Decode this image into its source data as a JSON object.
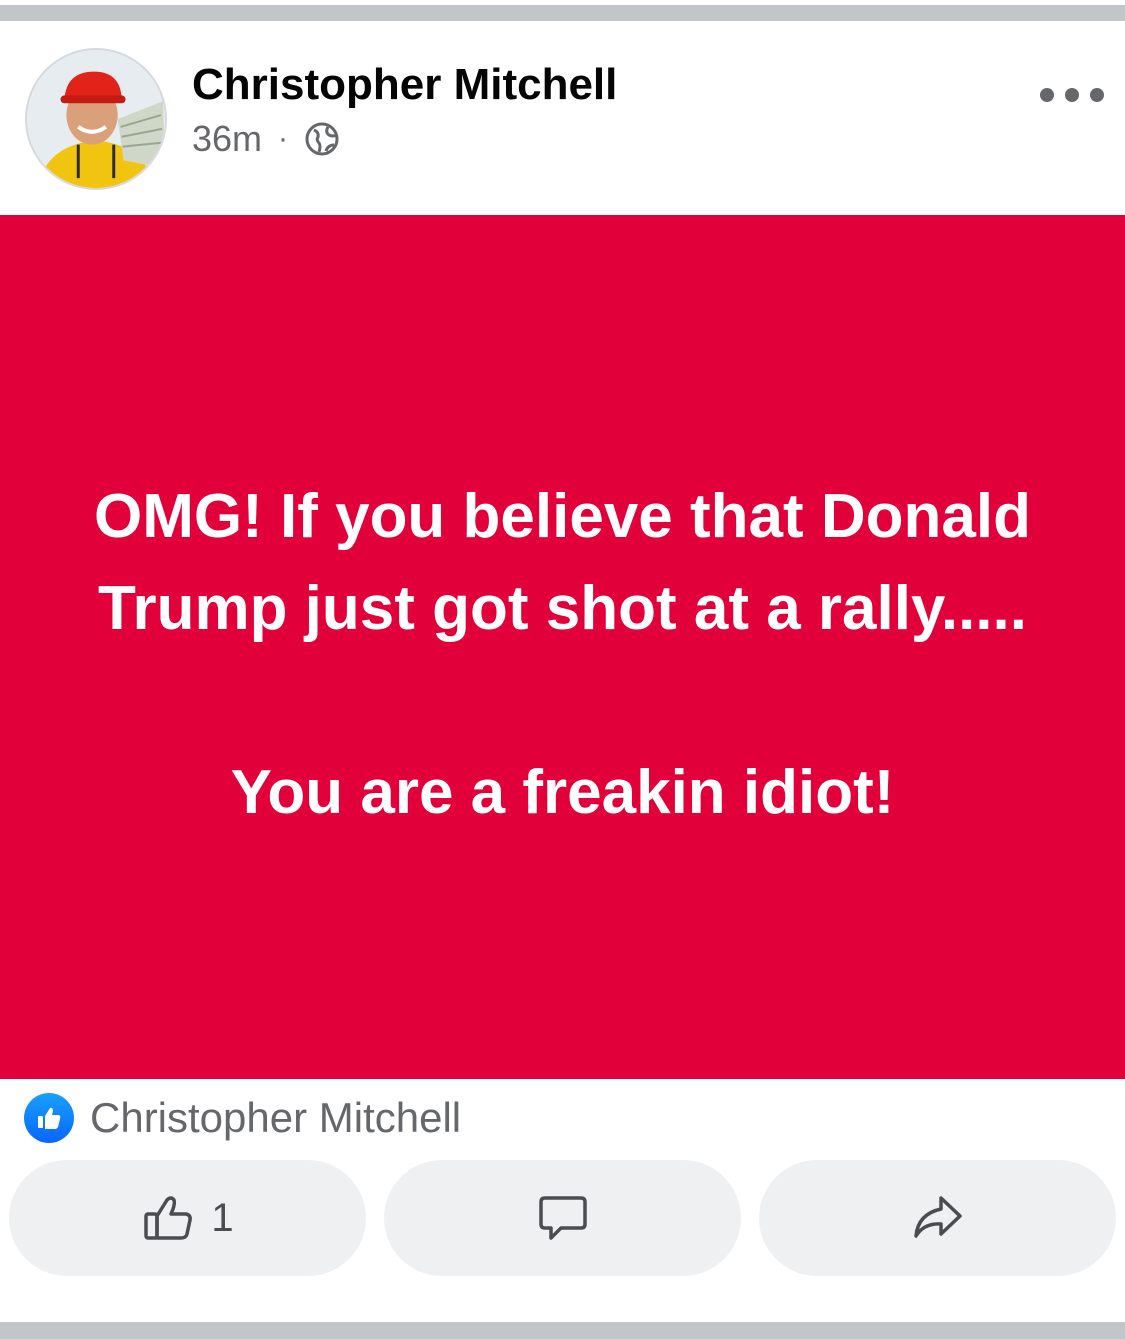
{
  "post": {
    "author": "Christopher Mitchell",
    "time": "36m",
    "separator": "·",
    "privacy_icon": "globe-icon",
    "text_lines": [
      "OMG! If you believe that Donald",
      "Trump just got shot at a rally.....",
      "",
      "You are a freakin idiot!"
    ],
    "background_color": "#e1003a",
    "text_color": "#ffffff"
  },
  "reactions": {
    "icon": "like-badge-icon",
    "reactor": "Christopher Mitchell"
  },
  "actions": {
    "like": {
      "icon": "thumbs-up-icon",
      "count": "1"
    },
    "comment": {
      "icon": "comment-icon"
    },
    "share": {
      "icon": "share-icon"
    }
  },
  "menu": {
    "icon": "more-options-icon"
  }
}
